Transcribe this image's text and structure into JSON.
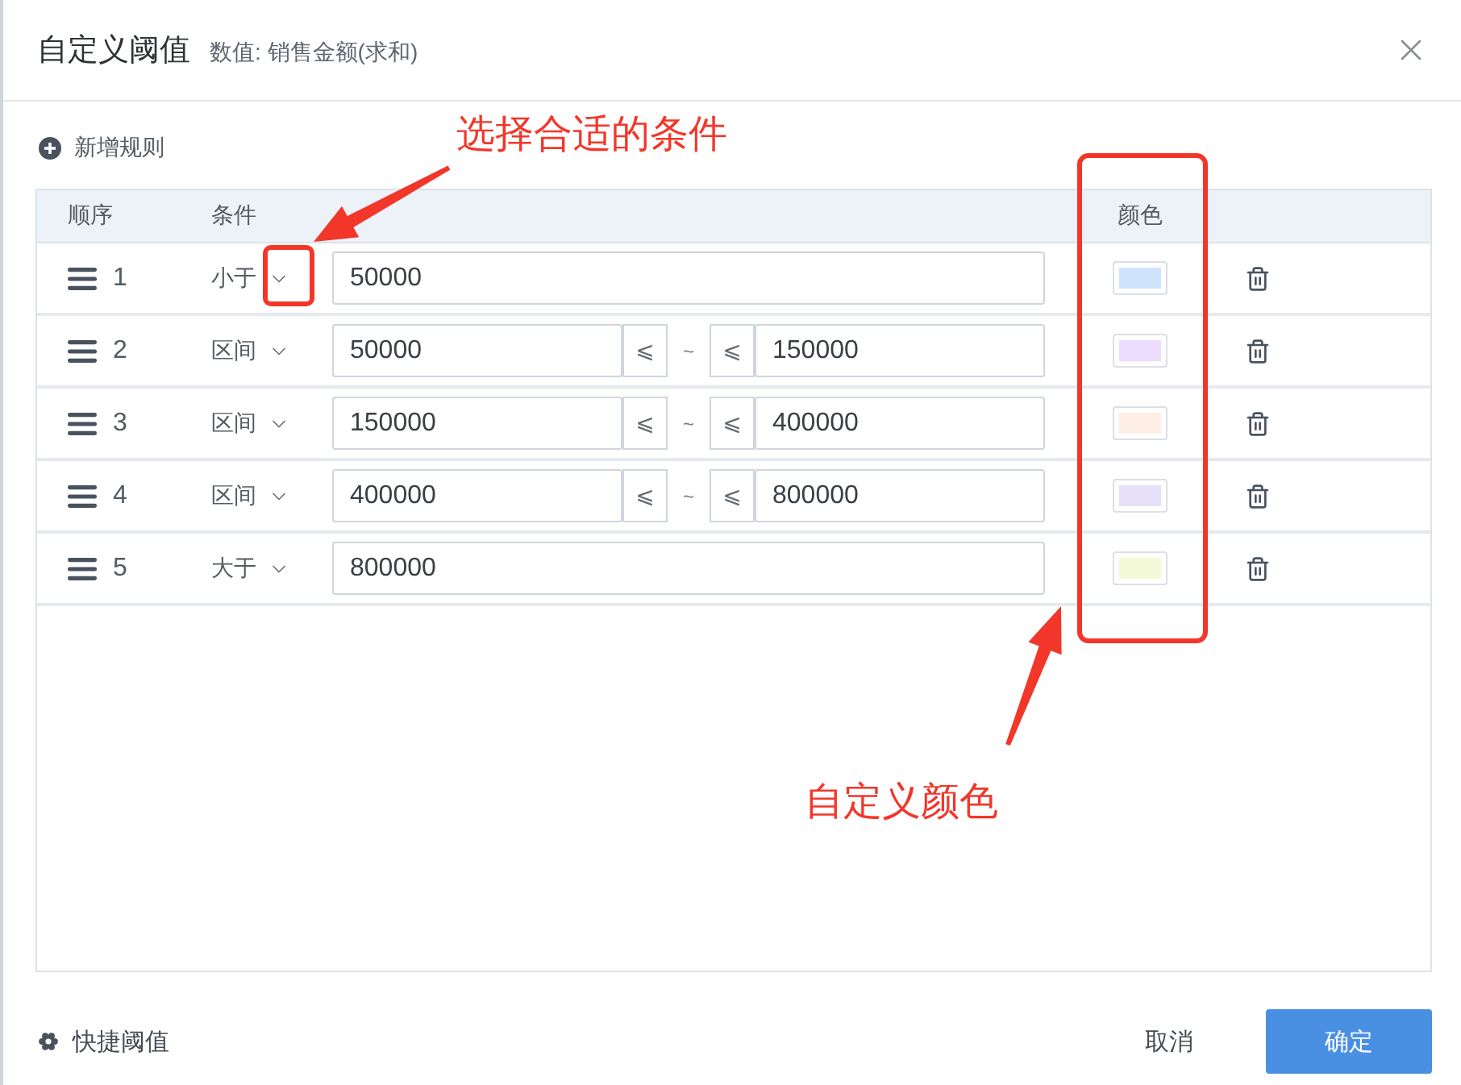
{
  "dialog": {
    "title": "自定义阈值",
    "subtitle": "数值: 销售金额(求和)"
  },
  "add_rule": {
    "label": "新增规则"
  },
  "table": {
    "columns": [
      "顺序",
      "条件",
      "颜色"
    ],
    "rows": [
      {
        "order": "1",
        "condition": "小于",
        "kind": "single",
        "value": "50000",
        "color": "#cfe3fd"
      },
      {
        "order": "2",
        "condition": "区间",
        "kind": "range",
        "from": "50000",
        "from_op": "⩽",
        "separator": "~",
        "to_op": "⩽",
        "to": "150000",
        "color": "#ecdcfd"
      },
      {
        "order": "3",
        "condition": "区间",
        "kind": "range",
        "from": "150000",
        "from_op": "⩽",
        "separator": "~",
        "to_op": "⩽",
        "to": "400000",
        "color": "#fdeee6"
      },
      {
        "order": "4",
        "condition": "区间",
        "kind": "range",
        "from": "400000",
        "from_op": "⩽",
        "separator": "~",
        "to_op": "⩽",
        "to": "800000",
        "color": "#e6e1f8"
      },
      {
        "order": "5",
        "condition": "大于",
        "kind": "single",
        "value": "800000",
        "color": "#f4fad8"
      }
    ]
  },
  "footer": {
    "quick_threshold": "快捷阈值",
    "buttons": [
      {
        "label": "取消",
        "kind": "secondary"
      },
      {
        "label": "确定",
        "kind": "primary"
      }
    ]
  },
  "annotations": [
    {
      "text": "选择合适的条件"
    },
    {
      "text": "自定义颜色"
    }
  ]
}
